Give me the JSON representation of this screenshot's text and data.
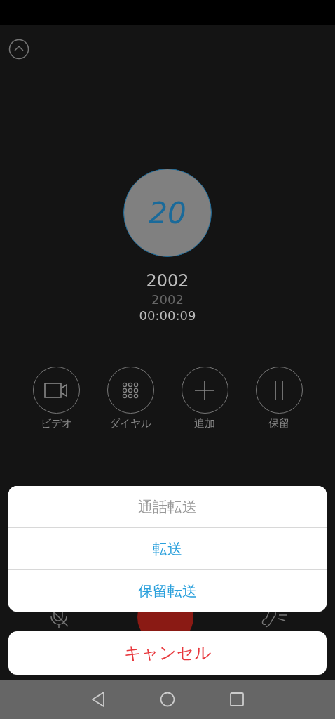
{
  "caller": {
    "avatar_text": "20",
    "name": "2002",
    "number": "2002",
    "duration": "00:00:09"
  },
  "actions": [
    {
      "kind": "video",
      "label": "ビデオ"
    },
    {
      "kind": "dialpad",
      "label": "ダイヤル"
    },
    {
      "kind": "add",
      "label": "追加"
    },
    {
      "kind": "hold",
      "label": "保留"
    }
  ],
  "sheet": {
    "title": "通話転送",
    "options": [
      "転送",
      "保留転送"
    ],
    "cancel": "キャンセル"
  }
}
